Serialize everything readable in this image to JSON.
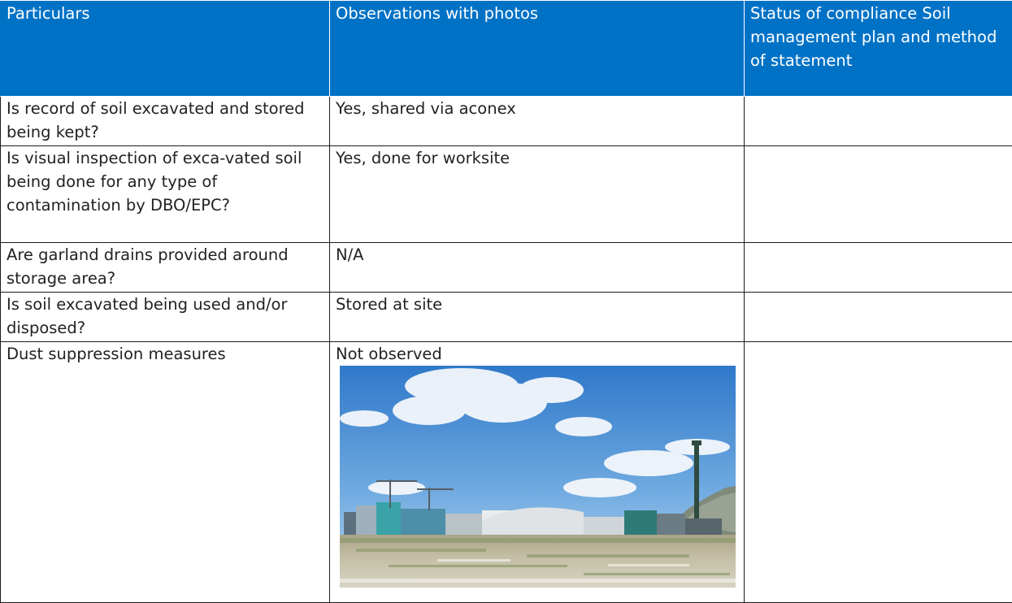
{
  "table": {
    "headers": [
      "Particulars",
      "Observations with photos",
      "Status of compliance Soil management plan and method of statement"
    ],
    "rows": [
      {
        "particular": "Is record of soil excavated and stored being kept?",
        "observation": "Yes, shared via aconex",
        "status": ""
      },
      {
        "particular": "Is visual inspection of exca-vated soil being done for any type of contamination by DBO/EPC?",
        "observation": "Yes, done for worksite",
        "status": ""
      },
      {
        "particular": "Are garland drains provided around storage area?",
        "observation": "N/A",
        "status": ""
      },
      {
        "particular": "Is soil excavated being used and/or disposed?",
        "observation": "Stored at site",
        "status": ""
      },
      {
        "particular": "Dust suppression measures",
        "observation": "Not observed",
        "status": ""
      }
    ]
  },
  "colors": {
    "header_background": "#0072c6",
    "header_text": "#ffffff",
    "border": "#1b1b1b"
  },
  "photo": {
    "icon": "construction-site-photo"
  }
}
